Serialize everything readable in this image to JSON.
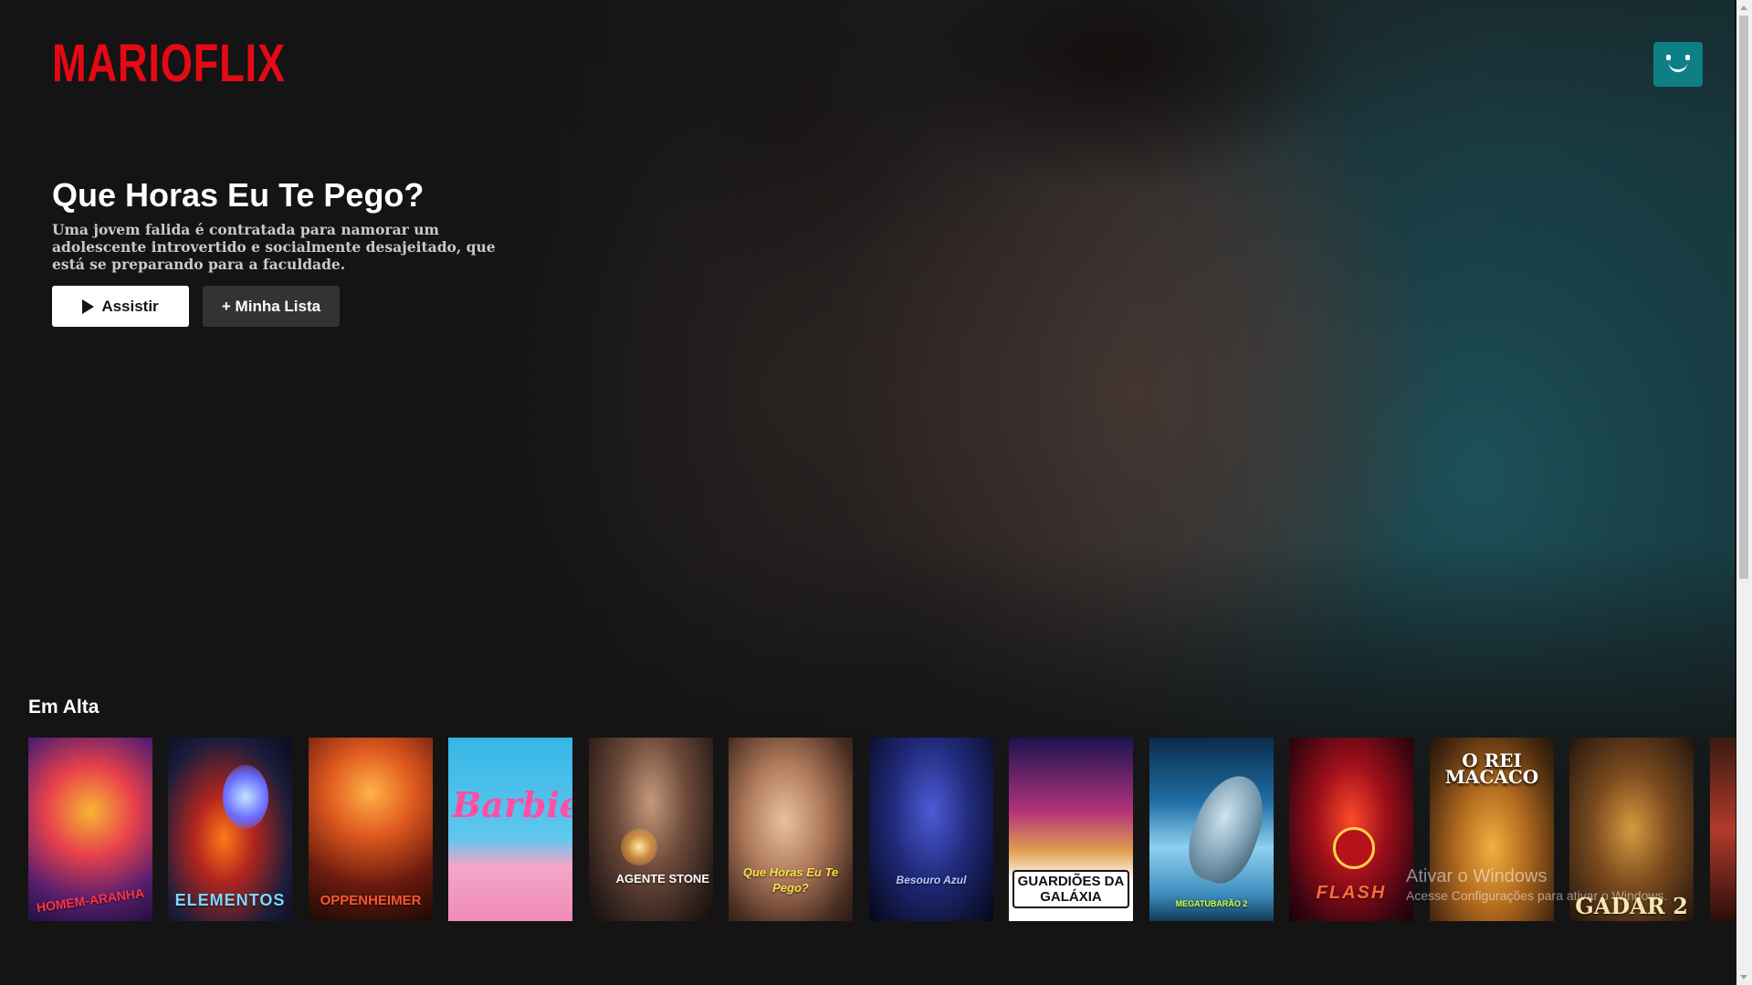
{
  "brand": {
    "logo_text": "MARIOFLIX",
    "accent_color": "#e50914"
  },
  "profile": {
    "avatar_icon": "smiley-face-icon",
    "avatar_color": "#0f7f86"
  },
  "featured": {
    "title": "Que Horas Eu Te Pego?",
    "description": "Uma jovem falida é contratada para namorar um adolescente introvertido e socialmente desajeitado, que está se preparando para a faculdade.",
    "play_label": "Assistir",
    "play_icon": "play-icon",
    "my_list_label": "+ Minha Lista"
  },
  "trending": {
    "title": "Em Alta",
    "posters": [
      {
        "caption": "HOMEM-ARANHA"
      },
      {
        "caption": "ELEMENTOS"
      },
      {
        "caption": "OPPENHEIMER"
      },
      {
        "caption": "Barbie"
      },
      {
        "caption": "AGENTE STONE"
      },
      {
        "caption": "Que Horas Eu Te Pego?"
      },
      {
        "caption": "Besouro Azul"
      },
      {
        "caption": "GUARDIÕES DA GALÁXIA"
      },
      {
        "caption": "MEGATUBARÃO 2"
      },
      {
        "caption": "FLASH"
      },
      {
        "caption": "O REI MACACO"
      },
      {
        "caption": "GADAR 2"
      },
      {
        "caption": ""
      }
    ]
  },
  "watermark": {
    "title": "Ativar o Windows",
    "subtitle": "Acesse Configurações para ativar o Windows."
  }
}
